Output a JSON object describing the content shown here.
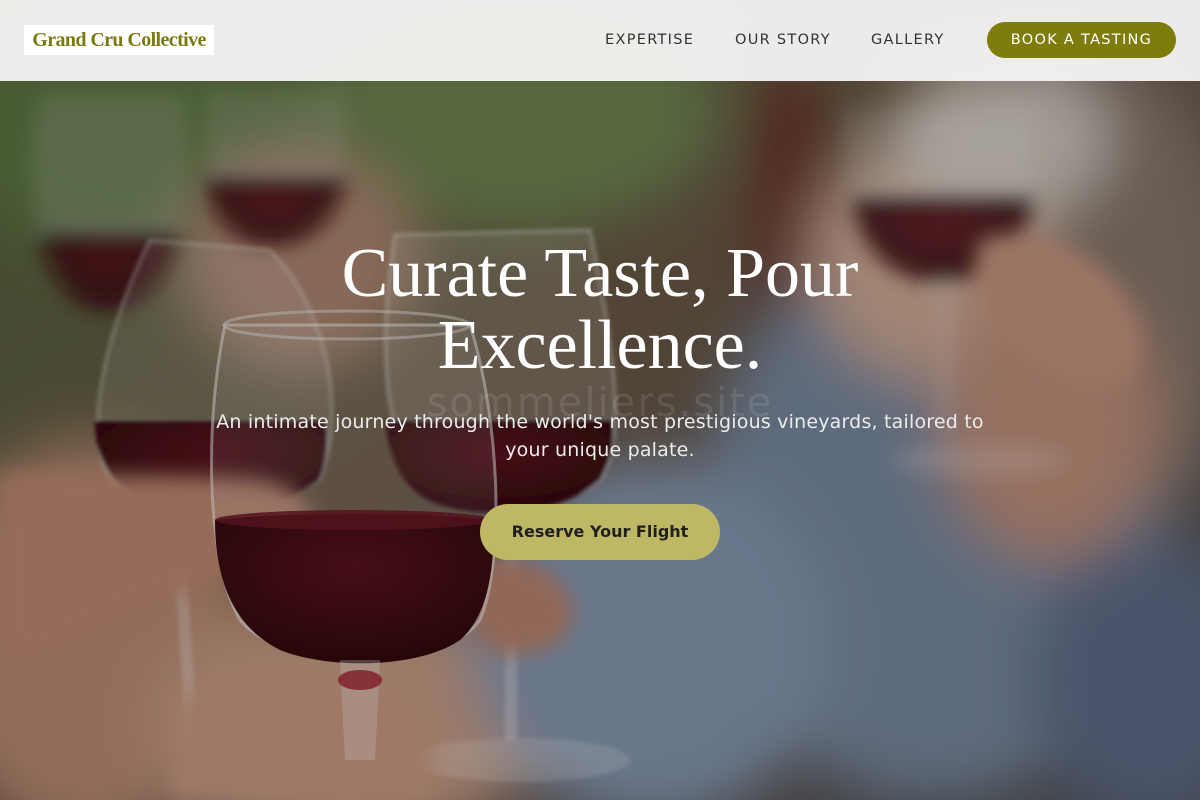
{
  "brand": {
    "name": "Grand Cru Collective"
  },
  "nav": {
    "items": [
      {
        "label": "EXPERTISE"
      },
      {
        "label": "OUR STORY"
      },
      {
        "label": "GALLERY"
      }
    ],
    "cta_label": "BOOK A TASTING"
  },
  "hero": {
    "headline_line1": "Curate Taste, Pour",
    "headline_line2": "Excellence.",
    "subtitle_line1": "An intimate journey through the world's most prestigious vineyards, tailored to",
    "subtitle_line2": "your unique palate.",
    "cta_label": "Reserve Your Flight",
    "watermark": "sommeliers.site"
  },
  "colors": {
    "header_bg": "#f4f3f1",
    "brand_olive": "#7e7c0c",
    "hero_button": "#beb864",
    "text_light": "#ffffff"
  }
}
